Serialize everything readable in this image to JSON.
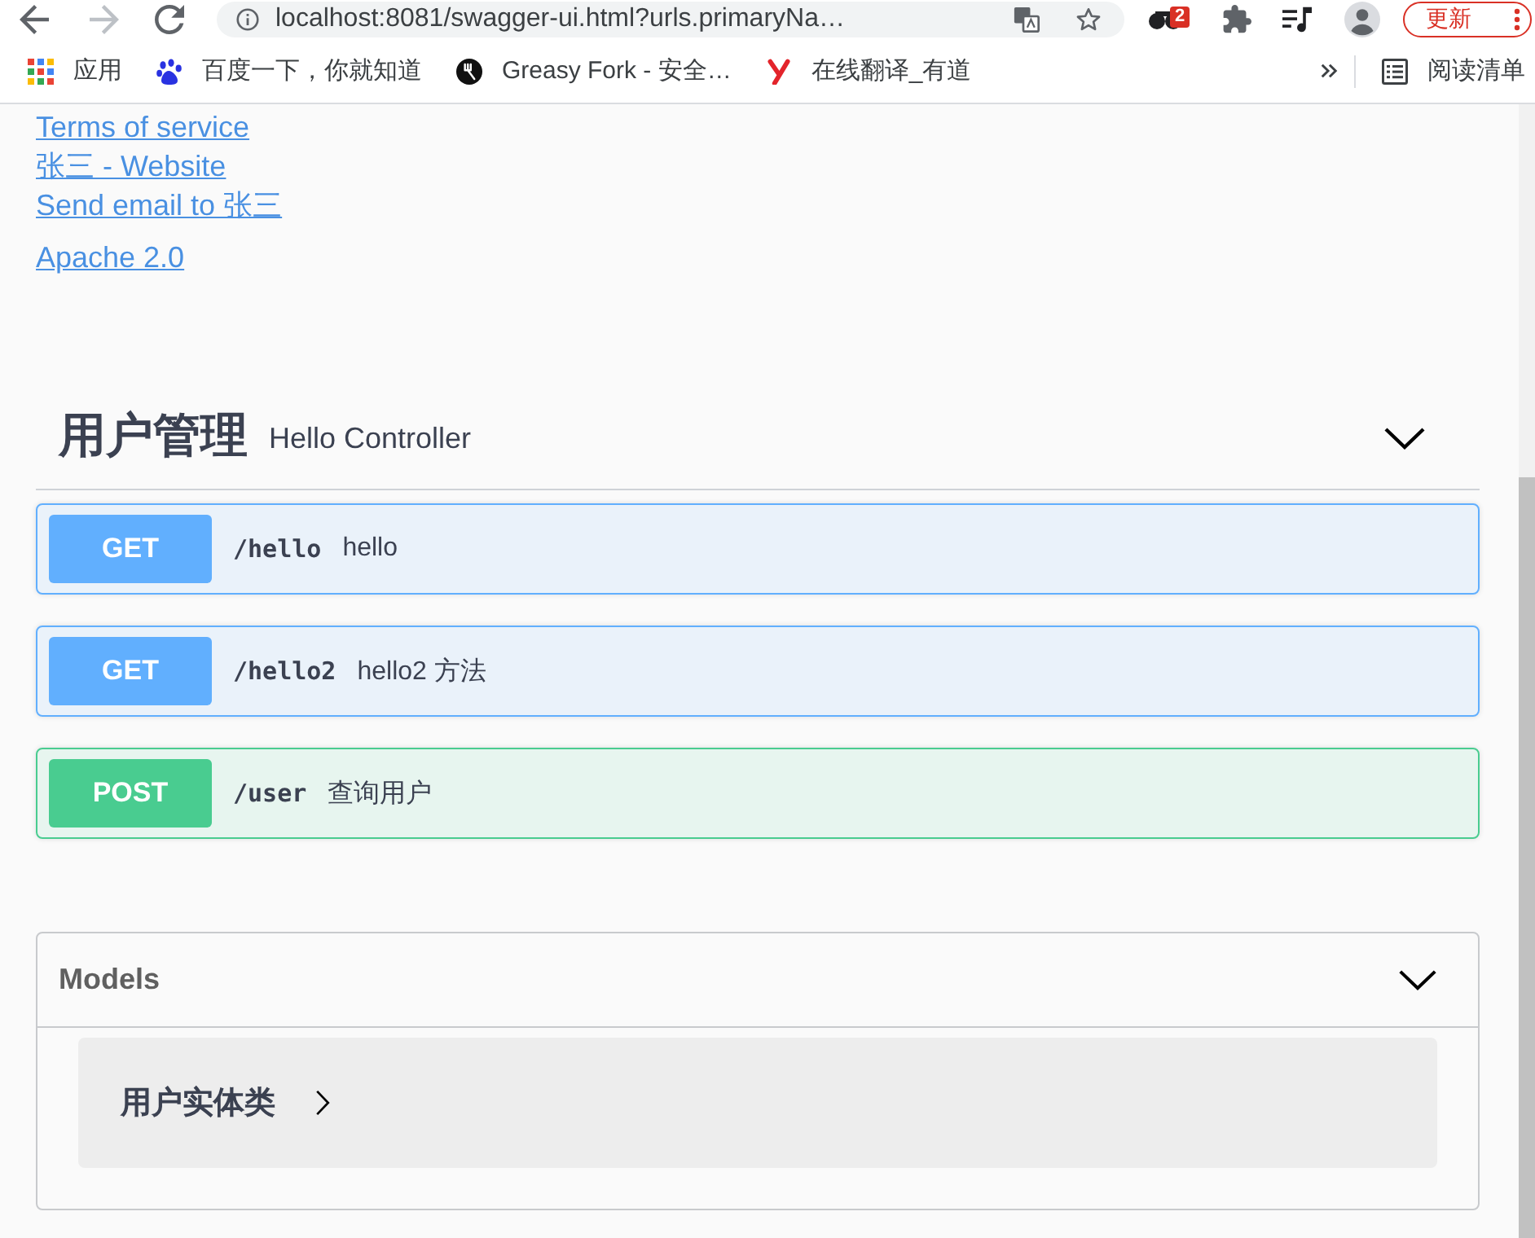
{
  "browser": {
    "navigation": {
      "back_disabled": false,
      "forward_disabled": true
    },
    "address": "localhost:8081/swagger-ui.html?urls.primaryNa…",
    "extension_badge": "2",
    "update_button": "更新"
  },
  "bookmarks": {
    "items": [
      {
        "label": "应用"
      },
      {
        "label": "百度一下，你就知道"
      },
      {
        "label": "Greasy Fork - 安全…"
      },
      {
        "label": "在线翻译_有道"
      }
    ],
    "reading_list": "阅读清单"
  },
  "info": {
    "terms_link": "Terms of service",
    "contact_links": [
      "张三 - Website",
      "Send email to 张三"
    ],
    "license_link": "Apache 2.0"
  },
  "tag": {
    "name": "用户管理",
    "description": "Hello Controller",
    "expanded": true,
    "operations": [
      {
        "method": "GET",
        "color": "#61affe",
        "path": "/hello",
        "summary": "hello"
      },
      {
        "method": "GET",
        "color": "#61affe",
        "path": "/hello2",
        "summary": "hello2 方法"
      },
      {
        "method": "POST",
        "color": "#49cc90",
        "path": "/user",
        "summary": "查询用户"
      }
    ]
  },
  "models": {
    "title": "Models",
    "expanded": true,
    "items": [
      {
        "name": "用户实体类",
        "expanded": false
      }
    ]
  }
}
